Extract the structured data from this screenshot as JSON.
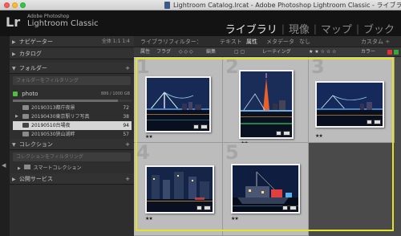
{
  "window": {
    "title": "Lightroom Catalog.lrcat - Adobe Photoshop Lightroom Classic - ライブラリ"
  },
  "identity": {
    "mark": "Lr",
    "line1": "Adobe Photoshop",
    "line2": "Lightroom Classic"
  },
  "modules": [
    "ライブラリ",
    "現像",
    "マップ",
    "ブック"
  ],
  "left_panel": {
    "navigator": {
      "label": "ナビゲーター",
      "options": "全体  1:1  1:4"
    },
    "catalog": {
      "label": "カタログ"
    },
    "folders": {
      "label": "フォルダー",
      "filter_placeholder": "フォルダーをフィルタリング",
      "volume": {
        "name": "photo",
        "size": "886 / 1000 GB",
        "used_fraction": 0.886
      },
      "items": [
        {
          "label": "20190313都庁夜景",
          "count": "72"
        },
        {
          "label": "20190430東京駅リフ写真",
          "count": "38"
        },
        {
          "label": "20190510台場夜",
          "count": "94"
        },
        {
          "label": "20190530狭山湖畔",
          "count": "57"
        }
      ]
    },
    "collections": {
      "label": "コレクション",
      "filter_placeholder": "コレクションをフィルタリング",
      "smart": "スマートコレクション"
    },
    "publish": {
      "label": "公開サービス"
    }
  },
  "filter_bar": {
    "items": [
      "ライブラリフィルター：",
      "テキスト",
      "属性",
      "メタデータ",
      "なし"
    ],
    "custom": "カスタム ÷"
  },
  "attribute_bar": {
    "attribute": "属性",
    "flag": "フラグ",
    "edit": "編集",
    "rating": "レーティング",
    "color": "カラー"
  },
  "grid": {
    "cells": [
      {
        "num": "1",
        "rating": "★★",
        "scene": "bridge"
      },
      {
        "num": "2",
        "rating": "★★",
        "scene": "tower"
      },
      {
        "num": "3",
        "rating": "★★",
        "scene": "bridge-wide"
      },
      {
        "num": "4",
        "rating": "★★",
        "scene": "city"
      },
      {
        "num": "5",
        "rating": "★★",
        "scene": "ship"
      }
    ]
  },
  "colors": {
    "accent_selection": "#e3e22a",
    "volume_led": "#4fbf3e"
  }
}
